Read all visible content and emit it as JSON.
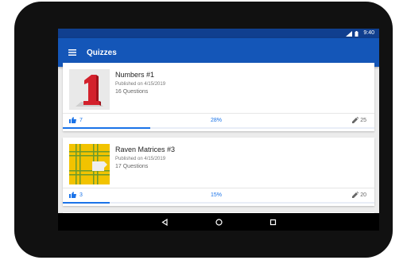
{
  "status": {
    "time": "9:40",
    "icons": [
      "signal-icon",
      "battery-icon"
    ]
  },
  "appbar": {
    "title": "Quizzes",
    "menu_icon": "menu-icon"
  },
  "quizzes": [
    {
      "title": "Numbers #1",
      "published": "Published on 4/15/2019",
      "questions": "16 Questions",
      "likes": "7",
      "percent_label": "28%",
      "percent": 0.28,
      "edits": "25"
    },
    {
      "title": "Raven Matrices #3",
      "published": "Published on 4/15/2019",
      "questions": "17 Questions",
      "likes": "3",
      "percent_label": "15%",
      "percent": 0.15,
      "edits": "20"
    }
  ],
  "colors": {
    "statusbar": "#103f8f",
    "appbar": "#1456b8",
    "accent": "#1a73e8"
  },
  "nav": {
    "buttons": [
      "back-icon",
      "home-icon",
      "recent-apps-icon"
    ]
  }
}
